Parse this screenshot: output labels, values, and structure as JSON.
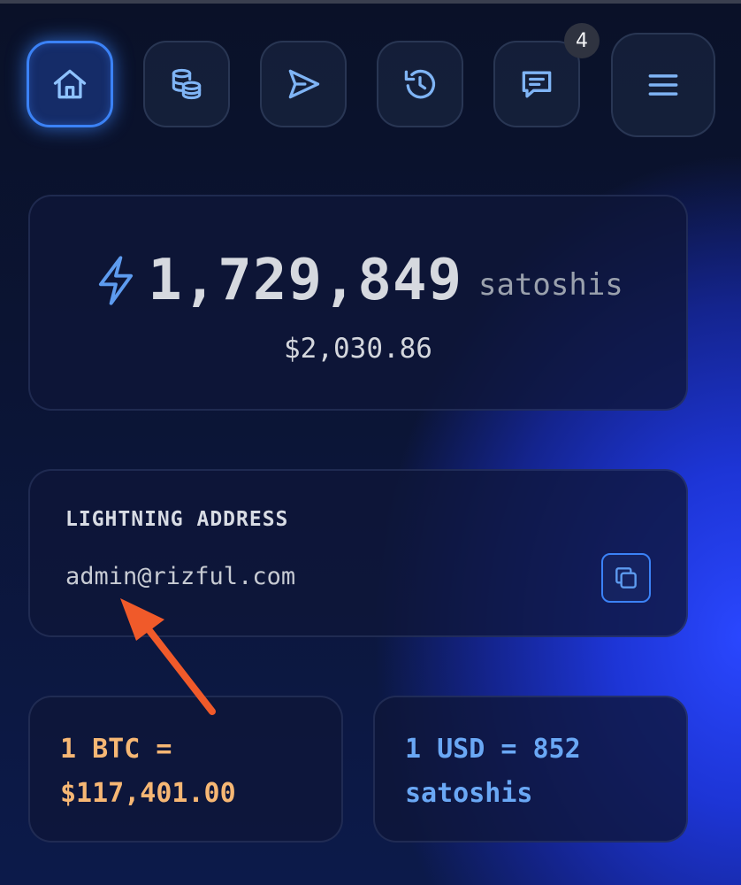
{
  "nav": {
    "items": [
      {
        "id": "home",
        "icon": "home-icon",
        "active": true
      },
      {
        "id": "coins",
        "icon": "coins-icon",
        "active": false
      },
      {
        "id": "send",
        "icon": "send-icon",
        "active": false
      },
      {
        "id": "history",
        "icon": "history-icon",
        "active": false
      },
      {
        "id": "messages",
        "icon": "chat-icon",
        "active": false,
        "badge": "4"
      },
      {
        "id": "menu",
        "icon": "hamburger-menu-icon",
        "active": false
      }
    ]
  },
  "balance": {
    "icon": "lightning-icon",
    "amount": "1,729,849",
    "unit": "satoshis",
    "fiat": "$2,030.86"
  },
  "lightning_address": {
    "label": "LIGHTNING ADDRESS",
    "value": "admin@rizful.com",
    "copy_icon": "copy-icon"
  },
  "rates": {
    "btc_line1": "1 BTC =",
    "btc_line2": "$117,401.00",
    "usd_line1": "1 USD = 852",
    "usd_line2": "satoshis"
  },
  "annotation": {
    "arrow_color": "#f05a2a"
  },
  "colors": {
    "accent": "#3b82f6",
    "btc_rate": "#f6b774",
    "usd_rate": "#6aa8f5"
  }
}
